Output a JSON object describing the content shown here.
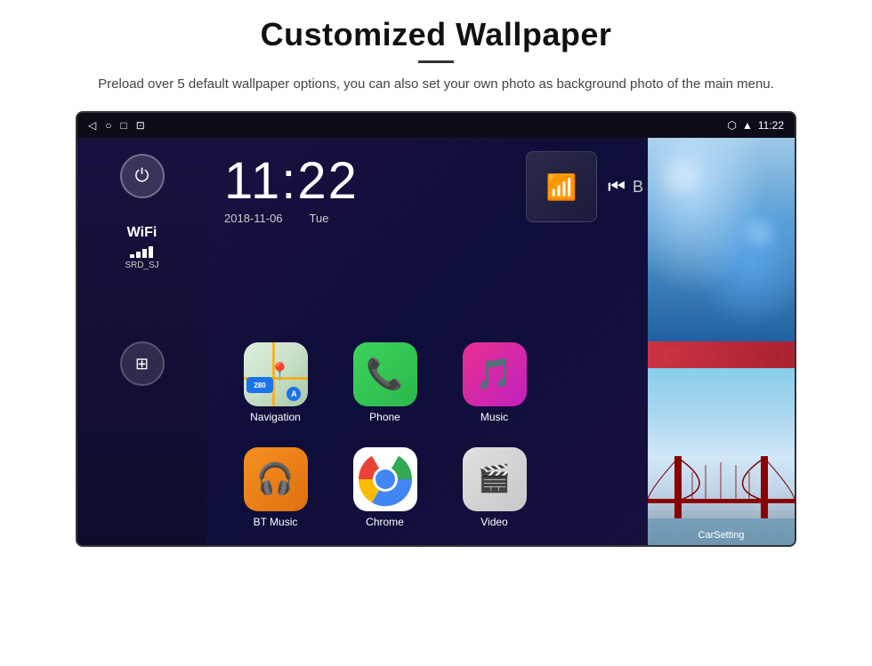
{
  "header": {
    "title": "Customized Wallpaper",
    "divider": true,
    "subtitle": "Preload over 5 default wallpaper options, you can also set your own photo as background photo of the main menu."
  },
  "device": {
    "statusBar": {
      "backIcon": "◁",
      "homeIcon": "○",
      "recentIcon": "□",
      "screenshotIcon": "⊡",
      "locationIcon": "▾",
      "wifiIcon": "▾",
      "time": "11:22"
    },
    "clock": {
      "time": "11:22",
      "date": "2018-11-06",
      "day": "Tue"
    },
    "wifi": {
      "label": "WiFi",
      "ssid": "SRD_SJ"
    },
    "apps": [
      {
        "name": "Navigation",
        "iconType": "navigation",
        "emoji": "🗺"
      },
      {
        "name": "Phone",
        "iconType": "phone",
        "emoji": "📞"
      },
      {
        "name": "Music",
        "iconType": "music",
        "emoji": "🎵"
      },
      {
        "name": "BT Music",
        "iconType": "bt",
        "emoji": "🎧"
      },
      {
        "name": "Chrome",
        "iconType": "chrome",
        "emoji": "⬤"
      },
      {
        "name": "Video",
        "iconType": "video",
        "emoji": "🎬"
      }
    ],
    "wallpapers": {
      "top": "ice-blue",
      "mid": "pink-bar",
      "bottom": "bridge"
    },
    "carSettingLabel": "CarSetting"
  }
}
